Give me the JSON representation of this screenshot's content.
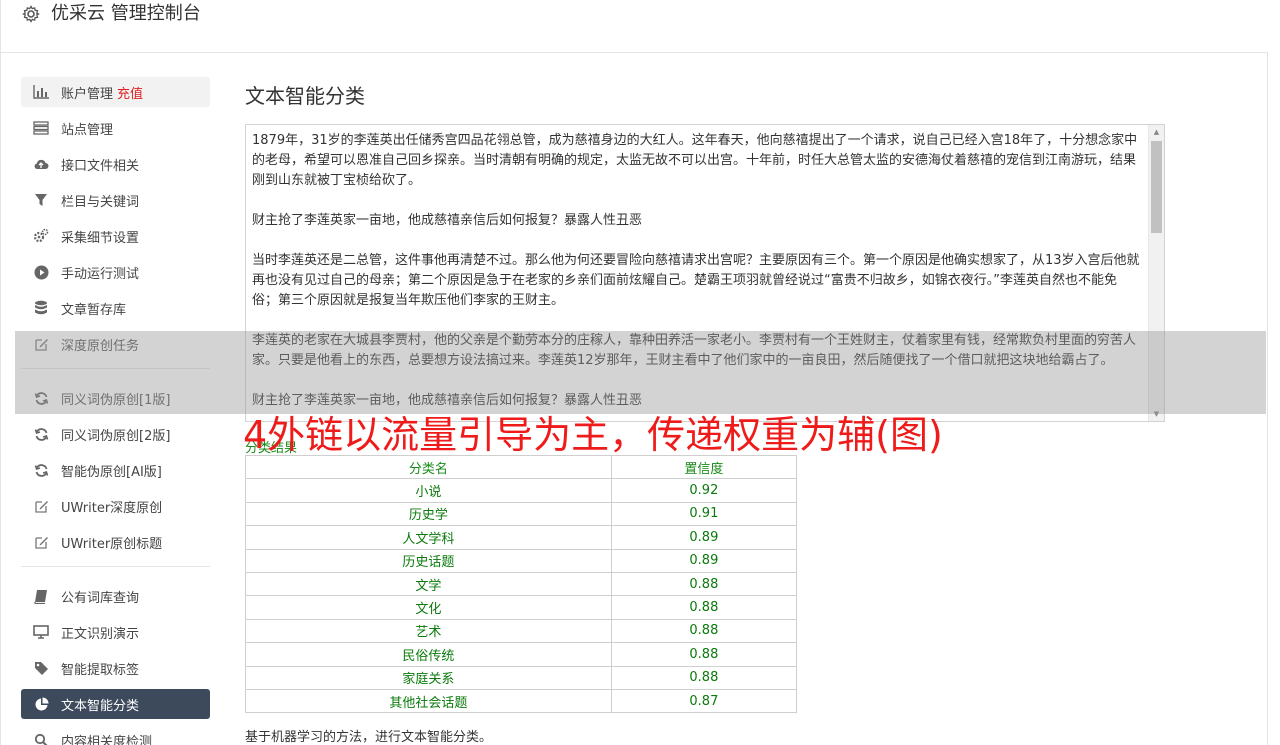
{
  "app": {
    "title": "优采云 管理控制台",
    "icon": "gear-icon"
  },
  "sidebar": {
    "items": [
      {
        "label": "账户管理",
        "extra": "充值",
        "icon": "bar-chart-icon"
      },
      {
        "label": "站点管理",
        "icon": "server-icon"
      },
      {
        "label": "接口文件相关",
        "icon": "cloud-upload-icon"
      },
      {
        "label": "栏目与关键词",
        "icon": "filter-icon"
      },
      {
        "label": "采集细节设置",
        "icon": "cogs-icon"
      },
      {
        "label": "手动运行测试",
        "icon": "play-circle-icon"
      },
      {
        "label": "文章暂存库",
        "icon": "database-icon"
      },
      {
        "label": "深度原创任务",
        "icon": "edit-icon"
      },
      {
        "label": "同义词伪原创[1版]",
        "icon": "refresh-icon"
      },
      {
        "label": "同义词伪原创[2版]",
        "icon": "refresh-icon"
      },
      {
        "label": "智能伪原创[AI版]",
        "icon": "refresh-icon"
      },
      {
        "label": "UWriter深度原创",
        "icon": "edit-icon"
      },
      {
        "label": "UWriter原创标题",
        "icon": "edit-icon"
      },
      {
        "label": "公有词库查询",
        "icon": "book-icon"
      },
      {
        "label": "正文识别演示",
        "icon": "monitor-icon"
      },
      {
        "label": "智能提取标签",
        "icon": "tag-icon"
      },
      {
        "label": "文本智能分类",
        "icon": "pie-chart-icon"
      },
      {
        "label": "内容相关度检测",
        "icon": "search-icon"
      }
    ],
    "active_index": 16
  },
  "main": {
    "title": "文本智能分类",
    "text_paragraphs": [
      "1879年，31岁的李莲英出任储秀宫四品花翎总管，成为慈禧身边的大红人。这年春天，他向慈禧提出了一个请求，说自己已经入宫18年了，十分想念家中的老母，希望可以恩准自己回乡探亲。当时清朝有明确的规定，太监无故不可以出宫。十年前，时任大总管太监的安德海仗着慈禧的宠信到江南游玩，结果刚到山东就被丁宝桢给砍了。",
      "财主抢了李莲英家一亩地，他成慈禧亲信后如何报复？暴露人性丑恶",
      "当时李莲英还是二总管，这件事他再清楚不过。那么他为何还要冒险向慈禧请求出宫呢？主要原因有三个。第一个原因是他确实想家了，从13岁入宫后他就再也没有见过自己的母亲；第二个原因是急于在老家的乡亲们面前炫耀自己。楚霸王项羽就曾经说过“富贵不归故乡，如锦衣夜行。”李莲英自然也不能免俗；第三个原因就是报复当年欺压他们李家的王财主。",
      "李莲英的老家在大城县李贾村，他的父亲是个勤劳本分的庄稼人，靠种田养活一家老小。李贾村有一个王姓财主，仗着家里有钱，经常欺负村里面的穷苦人家。只要是他看上的东西，总要想方设法搞过来。李莲英12岁那年，王财主看中了他们家中的一亩良田，然后随便找了一个借口就把这块地给霸占了。",
      "财主抢了李莲英家一亩地，他成慈禧亲信后如何报复？暴露人性丑恶"
    ],
    "banner": "4外链以流量引导为主，传递权重为辅(图)",
    "result_label": "分类结果",
    "table": {
      "headers": [
        "分类名",
        "置信度"
      ],
      "rows": [
        [
          "小说",
          "0.92"
        ],
        [
          "历史学",
          "0.91"
        ],
        [
          "人文学科",
          "0.89"
        ],
        [
          "历史话题",
          "0.89"
        ],
        [
          "文学",
          "0.88"
        ],
        [
          "文化",
          "0.88"
        ],
        [
          "艺术",
          "0.88"
        ],
        [
          "民俗传统",
          "0.88"
        ],
        [
          "家庭关系",
          "0.88"
        ],
        [
          "其他社会话题",
          "0.87"
        ]
      ]
    },
    "footnote": "基于机器学习的方法，进行文本智能分类。"
  },
  "colors": {
    "active_nav_bg": "#3d4a5c",
    "recharge": "#e02020",
    "banner": "#ef1a1a",
    "result_green": "#0a7a0a"
  }
}
